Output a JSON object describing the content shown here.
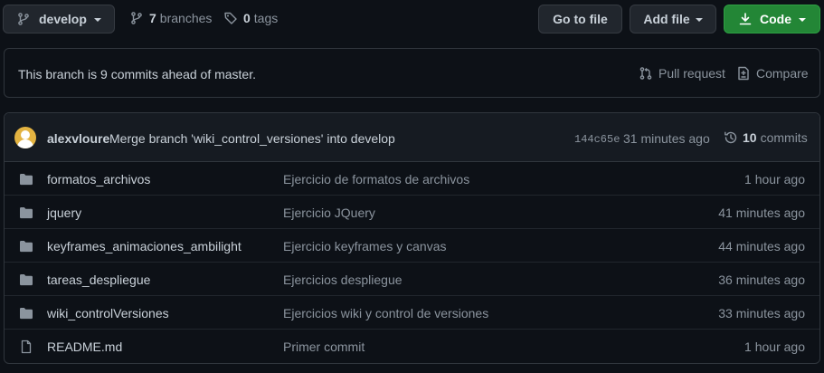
{
  "toolbar": {
    "branch_label": "develop",
    "branches_count": "7",
    "branches_label": "branches",
    "tags_count": "0",
    "tags_label": "tags",
    "goto_file_label": "Go to file",
    "add_file_label": "Add file",
    "code_label": "Code"
  },
  "ahead": {
    "text": "This branch is 9 commits ahead of master.",
    "pull_request_label": "Pull request",
    "compare_label": "Compare"
  },
  "latest_commit": {
    "author": "alexvloure",
    "message": "Merge branch 'wiki_control_versiones' into develop",
    "hash": "144c65e",
    "time": "31 minutes ago",
    "commits_count": "10",
    "commits_label": "commits"
  },
  "files": [
    {
      "type": "folder",
      "name": "formatos_archivos",
      "message": "Ejercicio de formatos de archivos",
      "age": "1 hour ago"
    },
    {
      "type": "folder",
      "name": "jquery",
      "message": "Ejercicio JQuery",
      "age": "41 minutes ago"
    },
    {
      "type": "folder",
      "name": "keyframes_animaciones_ambilight",
      "message": "Ejercicio keyframes y canvas",
      "age": "44 minutes ago"
    },
    {
      "type": "folder",
      "name": "tareas_despliegue",
      "message": "Ejercicios despliegue",
      "age": "36 minutes ago"
    },
    {
      "type": "folder",
      "name": "wiki_controlVersiones",
      "message": "Ejercicios wiki y control de versiones",
      "age": "33 minutes ago"
    },
    {
      "type": "file",
      "name": "README.md",
      "message": "Primer commit",
      "age": "1 hour ago"
    }
  ],
  "colors": {
    "background": "#0d1117",
    "border": "#30363d",
    "text": "#c9d1d9",
    "muted": "#8b949e",
    "code_button": "#238636",
    "folder_icon": "#8b949e"
  }
}
